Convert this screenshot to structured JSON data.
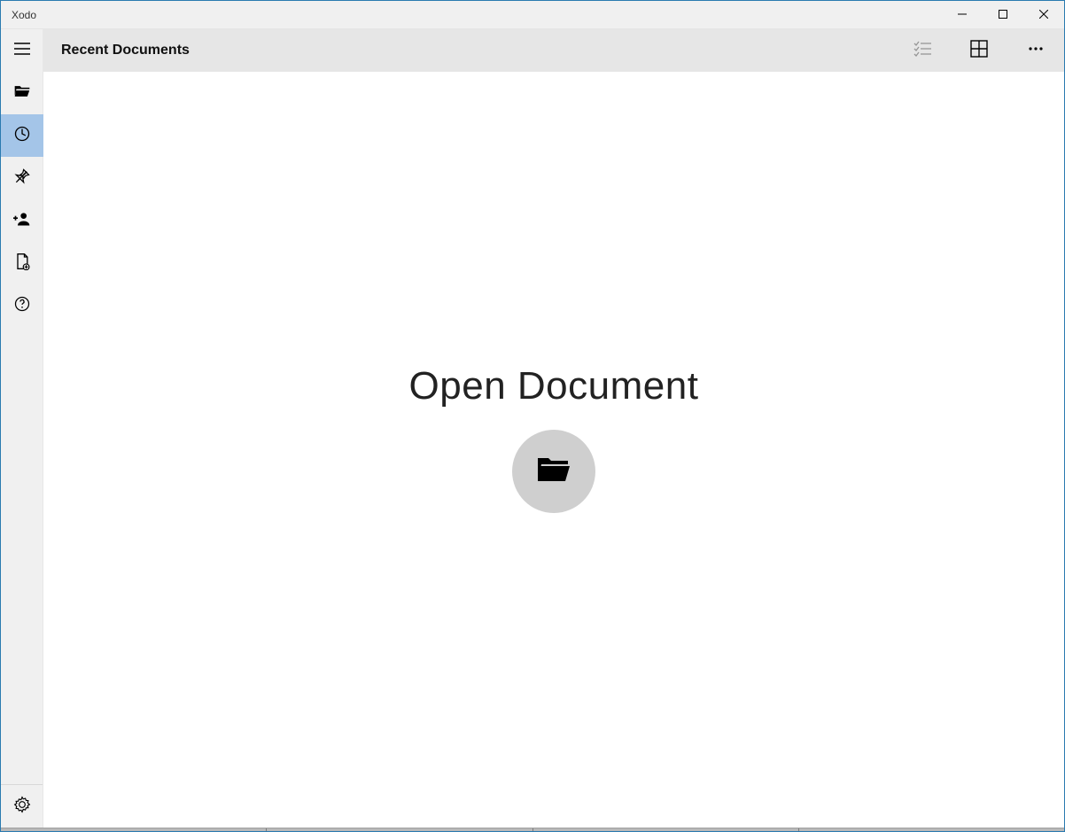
{
  "window": {
    "title": "Xodo"
  },
  "header": {
    "title": "Recent Documents"
  },
  "main": {
    "open_label": "Open Document"
  }
}
